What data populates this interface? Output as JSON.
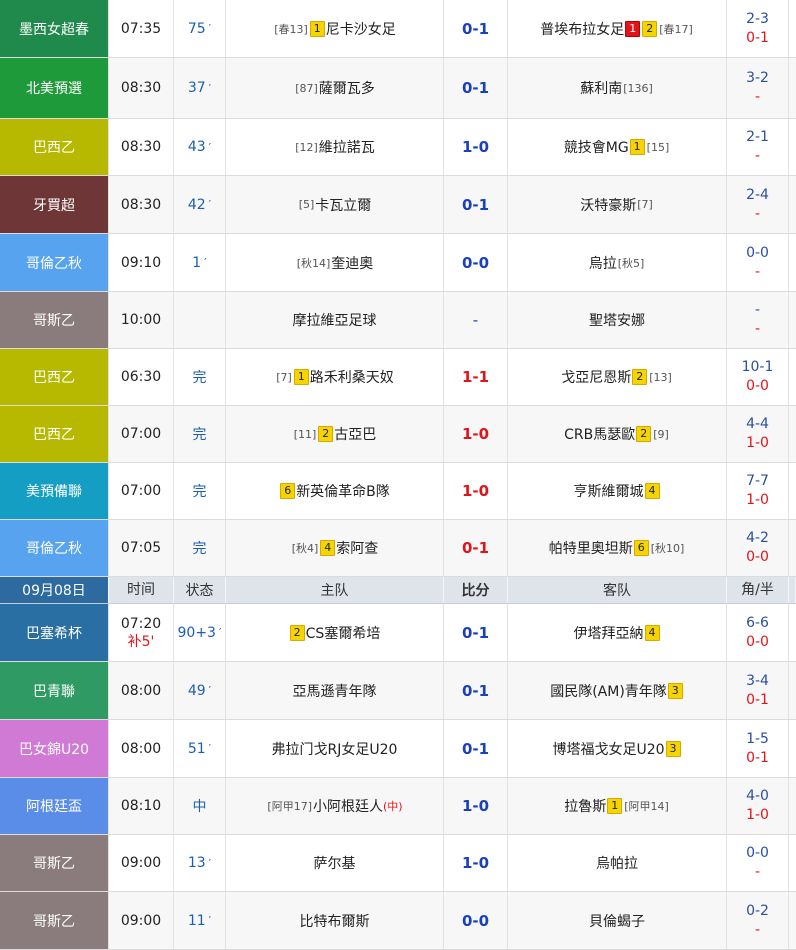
{
  "header": {
    "date": "09月08日",
    "time": "时间",
    "status": "状态",
    "home": "主队",
    "score": "比分",
    "away": "客队",
    "corner": "角/半"
  },
  "matches": [
    {
      "league": "墨西女超春",
      "color": "#1f8a4c",
      "time": "07:35",
      "status": "75",
      "min": true,
      "home_pre": "[春13]",
      "home_cards": [
        {
          "t": "y",
          "v": "1"
        }
      ],
      "home": "尼卡沙女足",
      "home_post": "",
      "score": "0-1",
      "score_color": "blue",
      "away": "普埃布拉女足",
      "away_cards": [
        {
          "t": "r",
          "v": "1"
        },
        {
          "t": "y",
          "v": "2"
        }
      ],
      "away_post": "[春17]",
      "corner": "2-3",
      "half": "0-1"
    },
    {
      "league": "北美預選",
      "color": "#1f9a3a",
      "time": "08:30",
      "status": "37",
      "min": true,
      "home_pre": "[87]",
      "home_cards": [],
      "home": "薩爾瓦多",
      "home_post": "",
      "score": "0-1",
      "score_color": "blue",
      "away": "蘇利南",
      "away_cards": [],
      "away_post": "[136]",
      "corner": "3-2",
      "half": "-"
    },
    {
      "league": "巴西乙",
      "color": "#b6b900",
      "time": "08:30",
      "status": "43",
      "min": true,
      "home_pre": "[12]",
      "home_cards": [],
      "home": "維拉諾瓦",
      "home_post": "",
      "score": "1-0",
      "score_color": "blue",
      "away": "競技會MG",
      "away_cards": [
        {
          "t": "y",
          "v": "1"
        }
      ],
      "away_post": "[15]",
      "corner": "2-1",
      "half": "-"
    },
    {
      "league": "牙買超",
      "color": "#6e3636",
      "time": "08:30",
      "status": "42",
      "min": true,
      "home_pre": "[5]",
      "home_cards": [],
      "home": "卡瓦立爾",
      "home_post": "",
      "score": "0-1",
      "score_color": "blue",
      "away": "沃特豪斯",
      "away_cards": [],
      "away_post": "[7]",
      "corner": "2-4",
      "half": "-"
    },
    {
      "league": "哥倫乙秋",
      "color": "#58a3f0",
      "time": "09:10",
      "status": "1",
      "min": true,
      "home_pre": "[秋14]",
      "home_cards": [],
      "home": "奎迪奧",
      "home_post": "",
      "score": "0-0",
      "score_color": "blue",
      "away": "烏拉",
      "away_cards": [],
      "away_post": "[秋5]",
      "corner": "0-0",
      "half": "-"
    },
    {
      "league": "哥斯乙",
      "color": "#8a7c7c",
      "time": "10:00",
      "status": "",
      "min": false,
      "home_pre": "",
      "home_cards": [],
      "home": "摩拉維亞足球",
      "home_post": "",
      "score": "-",
      "score_color": "dash",
      "away": "聖塔安娜",
      "away_cards": [],
      "away_post": "",
      "corner": "-",
      "half": "-"
    },
    {
      "league": "巴西乙",
      "color": "#b6b900",
      "time": "06:30",
      "status": "完",
      "min": false,
      "home_pre": "[7]",
      "home_cards": [
        {
          "t": "y",
          "v": "1"
        }
      ],
      "home": "路禾利桑天奴",
      "home_post": "",
      "score": "1-1",
      "score_color": "red",
      "away": "戈亞尼恩斯",
      "away_cards": [
        {
          "t": "y",
          "v": "2"
        }
      ],
      "away_post": "[13]",
      "corner": "10-1",
      "half": "0-0"
    },
    {
      "league": "巴西乙",
      "color": "#b6b900",
      "time": "07:00",
      "status": "完",
      "min": false,
      "home_pre": "[11]",
      "home_cards": [
        {
          "t": "y",
          "v": "2"
        }
      ],
      "home": "古亞巴",
      "home_post": "",
      "score": "1-0",
      "score_color": "red",
      "away": "CRB馬瑟歐",
      "away_cards": [
        {
          "t": "y",
          "v": "2"
        }
      ],
      "away_post": "[9]",
      "corner": "4-4",
      "half": "1-0"
    },
    {
      "league": "美預備聯",
      "color": "#159ec4",
      "time": "07:00",
      "status": "完",
      "min": false,
      "home_pre": "",
      "home_cards": [
        {
          "t": "y",
          "v": "6"
        }
      ],
      "home": "新英倫革命B隊",
      "home_post": "",
      "score": "1-0",
      "score_color": "red",
      "away": "亨斯維爾城",
      "away_cards": [
        {
          "t": "y",
          "v": "4"
        }
      ],
      "away_post": "",
      "corner": "7-7",
      "half": "1-0"
    },
    {
      "league": "哥倫乙秋",
      "color": "#58a3f0",
      "time": "07:05",
      "status": "完",
      "min": false,
      "home_pre": "[秋4]",
      "home_cards": [
        {
          "t": "y",
          "v": "4"
        }
      ],
      "home": "索阿查",
      "home_post": "",
      "score": "0-1",
      "score_color": "red",
      "away": "帕特里奧坦斯",
      "away_cards": [
        {
          "t": "y",
          "v": "6"
        }
      ],
      "away_post": "[秋10]",
      "corner": "4-2",
      "half": "0-0"
    }
  ],
  "matches2": [
    {
      "league": "巴塞希杯",
      "color": "#2a6fa3",
      "time": "07:20",
      "time2": "补5'",
      "status": "90+3",
      "min": true,
      "home_pre": "",
      "home_cards": [
        {
          "t": "y",
          "v": "2"
        }
      ],
      "home": "CS塞爾希培",
      "home_post": "",
      "score": "0-1",
      "score_color": "blue",
      "away": "伊塔拜亞納",
      "away_cards": [
        {
          "t": "y",
          "v": "4"
        }
      ],
      "away_post": "",
      "corner": "6-6",
      "half": "0-0"
    },
    {
      "league": "巴青聯",
      "color": "#2f9a63",
      "time": "08:00",
      "time2": "",
      "status": "49",
      "min": true,
      "home_pre": "",
      "home_cards": [],
      "home": "亞馬遜青年隊",
      "home_post": "",
      "score": "0-1",
      "score_color": "blue",
      "away": "國民隊(AM)青年隊",
      "away_cards": [
        {
          "t": "y",
          "v": "3"
        }
      ],
      "away_post": "",
      "corner": "3-4",
      "half": "0-1"
    },
    {
      "league": "巴女錦U20",
      "color": "#d07ad6",
      "time": "08:00",
      "time2": "",
      "status": "51",
      "min": true,
      "home_pre": "",
      "home_cards": [],
      "home": "弗拉门戈RJ女足U20",
      "home_post": "",
      "score": "0-1",
      "score_color": "blue",
      "away": "博塔福戈女足U20",
      "away_cards": [
        {
          "t": "y",
          "v": "3"
        }
      ],
      "away_post": "",
      "corner": "1-5",
      "half": "0-1"
    },
    {
      "league": "阿根廷盃",
      "color": "#5a8de8",
      "time": "08:10",
      "time2": "",
      "status": "中",
      "min": false,
      "home_pre": "[阿甲17]",
      "home_cards": [],
      "home": "小阿根廷人",
      "home_post": "(中)",
      "score": "1-0",
      "score_color": "blue",
      "away": "拉魯斯",
      "away_cards": [
        {
          "t": "y",
          "v": "1"
        }
      ],
      "away_post": "[阿甲14]",
      "corner": "4-0",
      "half": "1-0"
    },
    {
      "league": "哥斯乙",
      "color": "#8a7c7c",
      "time": "09:00",
      "time2": "",
      "status": "13",
      "min": true,
      "home_pre": "",
      "home_cards": [],
      "home": "萨尔基",
      "home_post": "",
      "score": "1-0",
      "score_color": "blue",
      "away": "烏帕拉",
      "away_cards": [],
      "away_post": "",
      "corner": "0-0",
      "half": "-"
    },
    {
      "league": "哥斯乙",
      "color": "#8a7c7c",
      "time": "09:00",
      "time2": "",
      "status": "11",
      "min": true,
      "home_pre": "",
      "home_cards": [],
      "home": "比特布爾斯",
      "home_post": "",
      "score": "0-0",
      "score_color": "blue",
      "away": "貝倫蝎子",
      "away_cards": [],
      "away_post": "",
      "corner": "0-2",
      "half": "-"
    }
  ]
}
